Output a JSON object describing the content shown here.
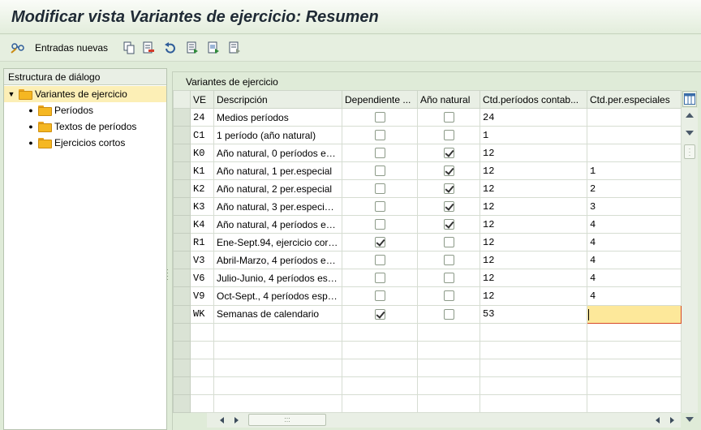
{
  "title": "Modificar vista Variantes de ejercicio: Resumen",
  "toolbar": {
    "new_entries_label": "Entradas nuevas",
    "icons": [
      "glasses-icon",
      "copy-icon",
      "delete-icon",
      "undo-icon",
      "select-all-icon",
      "select-block-icon",
      "deselect-all-icon"
    ]
  },
  "left_panel": {
    "header": "Estructura de diálogo",
    "root": "Variantes de ejercicio",
    "children": [
      "Períodos",
      "Textos de períodos",
      "Ejercicios cortos"
    ]
  },
  "table": {
    "caption": "Variantes de ejercicio",
    "headers": [
      "VE",
      "Descripción",
      "Dependiente ...",
      "Año natural",
      "Ctd.períodos contab...",
      "Ctd.per.especiales"
    ],
    "rows": [
      {
        "ve": "24",
        "desc": "Medios períodos",
        "dep": false,
        "anio": false,
        "ctd": "24",
        "esp": ""
      },
      {
        "ve": "C1",
        "desc": "1 período (año natural)",
        "dep": false,
        "anio": false,
        "ctd": "1",
        "esp": ""
      },
      {
        "ve": "K0",
        "desc": "Año natural, 0 períodos e…",
        "dep": false,
        "anio": true,
        "ctd": "12",
        "esp": ""
      },
      {
        "ve": "K1",
        "desc": "Año natural, 1 per.especial",
        "dep": false,
        "anio": true,
        "ctd": "12",
        "esp": "1"
      },
      {
        "ve": "K2",
        "desc": "Año natural, 2 per.especial",
        "dep": false,
        "anio": true,
        "ctd": "12",
        "esp": "2"
      },
      {
        "ve": "K3",
        "desc": "Año natural, 3 per.especi…",
        "dep": false,
        "anio": true,
        "ctd": "12",
        "esp": "3"
      },
      {
        "ve": "K4",
        "desc": "Año natural, 4 períodos e…",
        "dep": false,
        "anio": true,
        "ctd": "12",
        "esp": "4"
      },
      {
        "ve": "R1",
        "desc": "Ene-Sept.94, ejercicio cor…",
        "dep": true,
        "anio": false,
        "ctd": "12",
        "esp": "4"
      },
      {
        "ve": "V3",
        "desc": "Abril-Marzo, 4 períodos e…",
        "dep": false,
        "anio": false,
        "ctd": "12",
        "esp": "4"
      },
      {
        "ve": "V6",
        "desc": "Julio-Junio, 4 períodos es…",
        "dep": false,
        "anio": false,
        "ctd": "12",
        "esp": "4"
      },
      {
        "ve": "V9",
        "desc": "Oct-Sept., 4 períodos esp…",
        "dep": false,
        "anio": false,
        "ctd": "12",
        "esp": "4"
      },
      {
        "ve": "WK",
        "desc": "Semanas de calendario",
        "dep": true,
        "anio": false,
        "ctd": "53",
        "esp": ""
      }
    ],
    "empty_rows": 5,
    "focused_cell": "Ctd.per.especiales / WK"
  },
  "colors": {
    "accent": "#dfebd8",
    "folder": "#f5b722",
    "focus": "#fde89a"
  }
}
